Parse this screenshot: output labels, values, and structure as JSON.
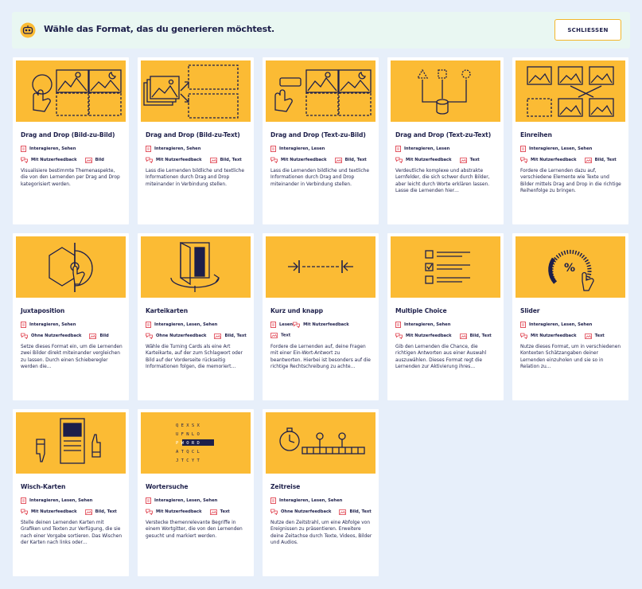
{
  "header": {
    "title": "Wähle das Format, das du generieren möchtest.",
    "close_label": "SCHLIESSEN"
  },
  "colors": {
    "accent": "#fbbb34",
    "ink": "#1d1f4a",
    "badge_red": "#e0424f",
    "background": "#e7effa",
    "header_bg": "#e9f7f2"
  },
  "cards": [
    {
      "title": "Drag and Drop (Bild-zu-Bild)",
      "skills": "Interagieren, Sehen",
      "feedback": "Mit Nutzerfeedback",
      "media": "Bild",
      "desc": "Visualisiere bestimmte Themenaspekte, die von den Lernenden per Drag and Drop kategorisiert werden.",
      "icon": "drag-drop-image-to-image-illustration"
    },
    {
      "title": "Drag and Drop (Bild-zu-Text)",
      "skills": "Interagieren, Sehen",
      "feedback": "Mit Nutzerfeedback",
      "media": "Bild, Text",
      "desc": "Lass die Lernenden bildliche und textliche Informationen durch Drag and Drop miteinander in Verbindung stellen.",
      "icon": "drag-drop-image-to-text-illustration"
    },
    {
      "title": "Drag and Drop (Text-zu-Bild)",
      "skills": "Interagieren, Lesen",
      "feedback": "Mit Nutzerfeedback",
      "media": "Bild, Text",
      "desc": "Lass die Lernenden bildliche und textliche Informationen durch Drag and Drop miteinander in Verbindung stellen.",
      "icon": "drag-drop-text-to-image-illustration"
    },
    {
      "title": "Drag and Drop (Text-zu-Text)",
      "skills": "Interagieren, Lesen",
      "feedback": "Mit Nutzerfeedback",
      "media": "Text",
      "desc": "Verdeutliche komplexe und abstrakte Lernfelder, die sich schwer durch Bilder, aber leicht durch Worte erklären lassen. Lasse die Lernenden hier…",
      "icon": "drag-drop-text-to-text-illustration"
    },
    {
      "title": "Einreihen",
      "skills": "Interagieren, Lesen, Sehen",
      "feedback": "Mit Nutzerfeedback",
      "media": "Bild, Text",
      "desc": "Fordere die Lernenden dazu auf, verschiedene Elemente wie Texte und Bilder mittels Drag and Drop in die richtige Reihenfolge zu bringen.",
      "icon": "sequence-illustration"
    },
    {
      "title": "Juxtaposition",
      "skills": "Interagieren, Sehen",
      "feedback": "Ohne Nutzerfeedback",
      "media": "Bild",
      "desc": "Setze dieses Format ein, um die Lernenden zwei Bilder direkt miteinander vergleichen zu lassen. Durch einen Schieberegler werden die…",
      "icon": "juxtaposition-illustration"
    },
    {
      "title": "Karteikarten",
      "skills": "Interagieren, Lesen, Sehen",
      "feedback": "Ohne Nutzerfeedback",
      "media": "Bild, Text",
      "desc": "Wähle die Turning Cards als eine Art Karteikarte, auf der zum Schlagwort oder Bild auf der Vorderseite rückseitig Informationen folgen, die memoriert…",
      "icon": "flashcard-illustration"
    },
    {
      "title": "Kurz und knapp",
      "skills": "Lesen",
      "feedback": "Mit Nutzerfeedback",
      "media": "Text",
      "desc": "Fordere die Lernenden auf, deine Fragen mit einer Ein-Wort-Antwort zu beantworten. Hierbei ist besonders auf die richtige Rechtschreibung zu achte…",
      "icon": "short-answer-illustration"
    },
    {
      "title": "Multiple Choice",
      "skills": "Interagieren, Sehen",
      "feedback": "Mit Nutzerfeedback",
      "media": "Bild, Text",
      "desc": "Gib den Lernenden die Chance, die richtigen Antworten aus einer Auswahl auszuwählen. Dieses Format regt die Lernenden zur Aktivierung ihres…",
      "icon": "multiple-choice-illustration"
    },
    {
      "title": "Slider",
      "skills": "Interagieren, Lesen, Sehen",
      "feedback": "Mit Nutzerfeedback",
      "media": "Text",
      "desc": "Nutze dieses Format, um in verschiedenen Kontexten Schätzangaben deiner Lernenden einzuholen und sie so in Relation zu…",
      "icon": "slider-illustration"
    },
    {
      "title": "Wisch-Karten",
      "skills": "Interagieren, Lesen, Sehen",
      "feedback": "Mit Nutzerfeedback",
      "media": "Bild, Text",
      "desc": "Stelle deinen Lernenden Karten mit Grafiken und Texten zur Verfügung, die sie nach einer Vorgabe sortieren. Das Wischen der Karten nach links oder…",
      "icon": "swipe-cards-illustration"
    },
    {
      "title": "Wortersuche",
      "skills": "Interagieren, Lesen, Sehen",
      "feedback": "Mit Nutzerfeedback",
      "media": "Text",
      "desc": "Verstecke themenrelevante Begriffe in einem Wortgitter, die von den Lernenden gesucht und markiert werden.",
      "icon": "word-search-illustration",
      "grid": [
        "Q E X S X",
        "U F N L O",
        "P W O R D",
        "A T Q C L",
        "J T C Y T"
      ]
    },
    {
      "title": "Zeitreise",
      "skills": "Interagieren, Lesen, Sehen",
      "feedback": "Ohne Nutzerfeedback",
      "media": "Bild, Text",
      "desc": "Nutze den Zeitstrahl, um eine Abfolge von Ereignissen zu präsentieren. Erweitere deine Zeitachse durch Texte, Videos, Bilder und Audios.",
      "icon": "timeline-illustration"
    }
  ]
}
